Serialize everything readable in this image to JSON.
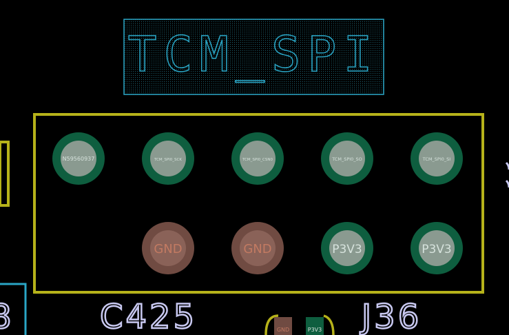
{
  "board": {
    "label_box_text": "TCM_SPI",
    "designator_left": "C425",
    "designator_right": "J36",
    "left_partial_glyph": "8"
  },
  "pads_top_row": [
    {
      "net": "N59560937"
    },
    {
      "net": "TCM_SPI0_SCK"
    },
    {
      "net": "TCM_SPI0_CSN0"
    },
    {
      "net": "TCM_SPI0_SO"
    },
    {
      "net": "TCM_SPI0_SI"
    }
  ],
  "pads_bottom_row": [
    {
      "net": "GND"
    },
    {
      "net": "GND"
    },
    {
      "net": "P3V3"
    },
    {
      "net": "P3V3"
    }
  ],
  "small_pads": [
    {
      "net": "GND"
    },
    {
      "net": "P3V3"
    }
  ],
  "colors": {
    "background": "#000000",
    "silkscreen": "#c8c8f0",
    "courtyard_outline": "#b6b21a",
    "fab_box": "#2aa6c6",
    "pad_green": "#0e5e3f",
    "pad_copper": "#704b42",
    "hole_gray": "#8a9a90",
    "pad_text_copper": "#c27a62",
    "pad_text_green": "#d6e2dc"
  }
}
